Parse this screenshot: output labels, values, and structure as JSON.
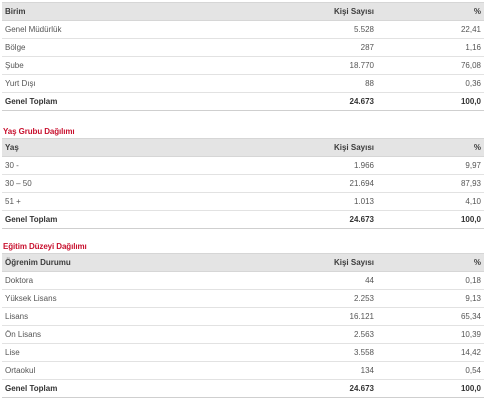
{
  "section1": {
    "headers": [
      "Birim",
      "Kişi Sayısı",
      "%"
    ],
    "rows": [
      [
        "Genel Müdürlük",
        "5.528",
        "22,41"
      ],
      [
        "Bölge",
        "287",
        "1,16"
      ],
      [
        "Şube",
        "18.770",
        "76,08"
      ],
      [
        "Yurt Dışı",
        "88",
        "0,36"
      ]
    ],
    "total": [
      "Genel Toplam",
      "24.673",
      "100,0"
    ]
  },
  "section2": {
    "title": "Yaş Grubu Dağılımı",
    "headers": [
      "Yaş",
      "Kişi Sayısı",
      "%"
    ],
    "rows": [
      [
        "30 -",
        "1.966",
        "9,97"
      ],
      [
        "30 – 50",
        "21.694",
        "87,93"
      ],
      [
        "51 +",
        "1.013",
        "4,10"
      ]
    ],
    "total": [
      "Genel Toplam",
      "24.673",
      "100,0"
    ]
  },
  "section3": {
    "title": "Eğitim Düzeyi Dağılımı",
    "headers": [
      "Öğrenim Durumu",
      "Kişi Sayısı",
      "%"
    ],
    "rows": [
      [
        "Doktora",
        "44",
        "0,18"
      ],
      [
        "Yüksek Lisans",
        "2.253",
        "9,13"
      ],
      [
        "Lisans",
        "16.121",
        "65,34"
      ],
      [
        "Ön Lisans",
        "2.563",
        "10,39"
      ],
      [
        "Lise",
        "3.558",
        "14,42"
      ],
      [
        "Ortaokul",
        "134",
        "0,54"
      ]
    ],
    "total": [
      "Genel Toplam",
      "24.673",
      "100,0"
    ]
  },
  "colors": {
    "title_red": "#c8102e",
    "header_bg": "#e4e4e4"
  }
}
